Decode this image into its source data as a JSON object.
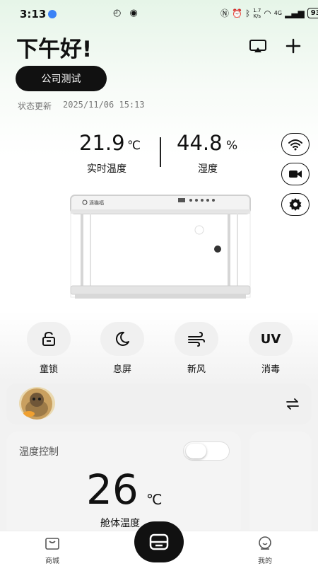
{
  "status_bar": {
    "time": "3:13",
    "net_speed_top": "1.7",
    "net_speed_bottom": "K/s",
    "signal": "4G",
    "battery": "93"
  },
  "header": {
    "greeting": "下午好!",
    "device_name": "公司测试",
    "update_label": "状态更新",
    "update_time": "2025/11/06 15:13"
  },
  "readings": {
    "temperature": {
      "value": "21.9",
      "unit": "℃",
      "label": "实时温度"
    },
    "humidity": {
      "value": "44.8",
      "unit": "%",
      "label": "湿度"
    }
  },
  "side_buttons": [
    {
      "icon": "wifi-icon"
    },
    {
      "icon": "camera-icon"
    },
    {
      "icon": "gear-icon"
    }
  ],
  "cabinet": {
    "brand_text": "滴猫福"
  },
  "features": [
    {
      "icon": "lock-icon",
      "label": "童锁"
    },
    {
      "icon": "moon-icon",
      "label": "息屏"
    },
    {
      "icon": "wind-icon",
      "label": "新风"
    },
    {
      "icon": "uv-icon",
      "icon_text": "UV",
      "label": "消毒"
    }
  ],
  "temp_control": {
    "title": "温度控制",
    "setpoint": "26",
    "unit": "℃",
    "label": "舱体温度",
    "toggle_on": false
  },
  "bottom_nav": {
    "left": {
      "icon": "shop-icon",
      "label": "商城"
    },
    "center": {
      "icon": "device-icon"
    },
    "right": {
      "icon": "profile-icon",
      "label": "我的"
    }
  },
  "colors": {
    "accent": "#111111",
    "card_bg": "#f4f4f4",
    "status_dot": "#3b82f6"
  }
}
